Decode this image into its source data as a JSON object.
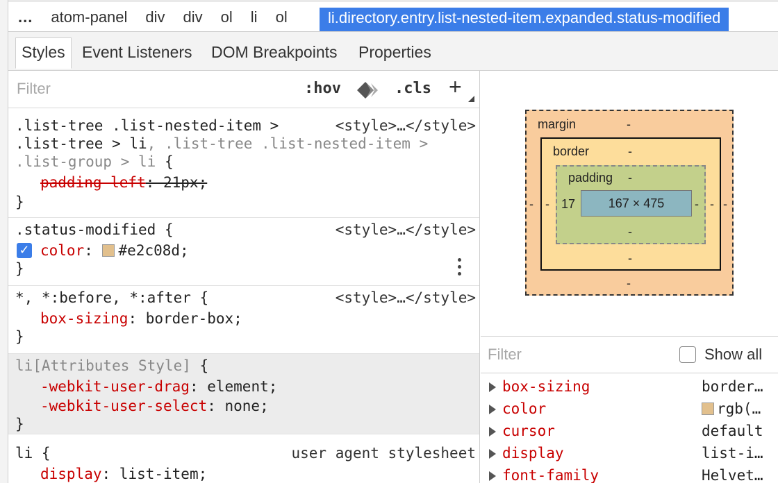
{
  "breadcrumb": {
    "ellipsis": "...",
    "items": [
      "atom-panel",
      "div",
      "div",
      "ol",
      "li",
      "ol"
    ],
    "selected": "li.directory.entry.list-nested-item.expanded.status-modified"
  },
  "tabs": [
    "Styles",
    "Event Listeners",
    "DOM Breakpoints",
    "Properties"
  ],
  "styles_filter": {
    "placeholder": "Filter",
    "hov": ":hov",
    "cls": ".cls",
    "add": "+"
  },
  "rules": {
    "r1": {
      "sel_l1": ".list-tree .list-nested-item >",
      "sel_l2a": ".list-tree > li",
      "sel_l2b": ", .list-tree .list-nested-item >",
      "sel_l3a": ".list-group > li",
      "sel_l3b": " {",
      "prop": "padding-left",
      "val": ": 21px;",
      "close": "}",
      "source": "<style>…</style>"
    },
    "r2": {
      "selector": ".status-modified {",
      "check": "✓",
      "prop": "color",
      "colon": ": ",
      "value": "#e2c08d;",
      "close": "}",
      "source": "<style>…</style>"
    },
    "r3": {
      "selector_a": "*, *:before, *:after",
      "selector_b": " {",
      "prop": "box-sizing",
      "value": ": border-box;",
      "close": "}",
      "source": "<style>…</style>"
    },
    "r4": {
      "selector": "li[Attributes Style]",
      "brace": " {",
      "prop1": "-webkit-user-drag",
      "val1": ": element;",
      "prop2": "-webkit-user-select",
      "val2": ": none;",
      "close": "}"
    },
    "r5": {
      "selector": "li {",
      "source": "user agent stylesheet",
      "prop": "display",
      "value": ": list-item;"
    }
  },
  "box_model": {
    "margin_label": "margin",
    "margin_top": "-",
    "margin_bottom": "-",
    "margin_left": "-",
    "margin_right": "-",
    "border_label": "border",
    "border_top": "-",
    "border_bottom": "-",
    "border_left": "-",
    "border_right": "-",
    "padding_label": "padding",
    "padding_top": "-",
    "padding_bottom": "-",
    "padding_left": "17",
    "padding_right": "-",
    "content": "167 × 475"
  },
  "computed": {
    "filter_placeholder": "Filter",
    "show_all": "Show all",
    "rows": [
      {
        "prop": "box-sizing",
        "value": "border…"
      },
      {
        "prop": "color",
        "value": "rgb(…"
      },
      {
        "prop": "cursor",
        "value": "default"
      },
      {
        "prop": "display",
        "value": "list-i…"
      },
      {
        "prop": "font-family",
        "value": "Helvet…"
      }
    ]
  },
  "colors": {
    "selected_crumb": "#3b7de8",
    "property_name": "#c80000",
    "swatch": "#e2c08d",
    "margin_box": "#f9cc9d",
    "border_box": "#fddd9b",
    "padding_box": "#c3d08b",
    "content_box": "#8cb6c0"
  }
}
